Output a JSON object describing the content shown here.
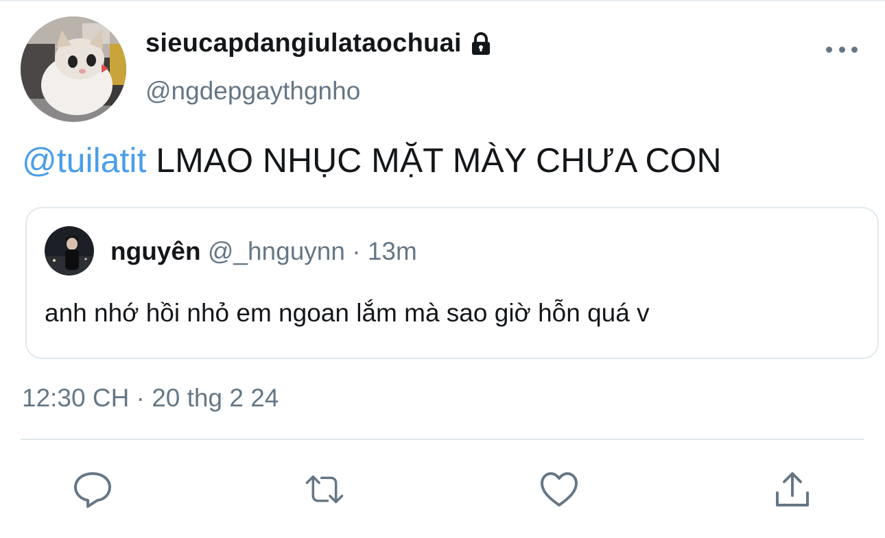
{
  "tweet": {
    "display_name": "sieucapdangiulataochuai",
    "handle": "@ngdepgaythgnho",
    "mention": "@tuilatit",
    "text": " LMAO NHỤC MẶT MÀY CHƯA CON",
    "timestamp": "12:30 CH · 20 thg 2 24"
  },
  "quoted_tweet": {
    "name": "nguyên",
    "handle_and_time": " @_hnguynn · 13m",
    "text": "anh nhớ hồi nhỏ em ngoan lắm mà sao giờ hỗn quá v"
  },
  "icons": {
    "lock": "lock-icon",
    "more": "more-options-icon",
    "reply": "reply-icon",
    "retweet": "retweet-icon",
    "like": "heart-icon",
    "share": "share-icon"
  },
  "colors": {
    "mention": "#4a9ee8",
    "secondary_text": "#657786",
    "border": "#e1e8ed"
  }
}
